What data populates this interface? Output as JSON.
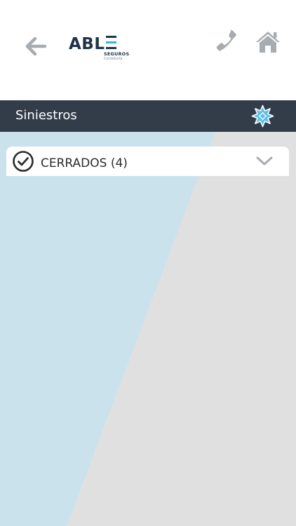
{
  "header": {
    "logo": {
      "main": "ABL",
      "sub": "SEGUROS",
      "sub2": "Correduría"
    },
    "icons": {
      "back": "arrow-left-icon",
      "phone": "phone-icon",
      "home": "home-icon"
    }
  },
  "title_bar": {
    "title": "Siniestros",
    "action_icon": "star-burst-icon"
  },
  "sections": [
    {
      "label": "CERRADOS (4)",
      "status_icon": "check-circle-icon",
      "toggle_icon": "chevron-down-icon"
    }
  ],
  "colors": {
    "title_bar": "#333d4a",
    "background_grey": "#e0e0e0",
    "background_blue": "#cae2ec",
    "icon_grey": "#a7acb1",
    "brand_dark": "#1f3448",
    "brand_accent": "#3bb3e0",
    "star_accent": "#5fc0e8"
  }
}
